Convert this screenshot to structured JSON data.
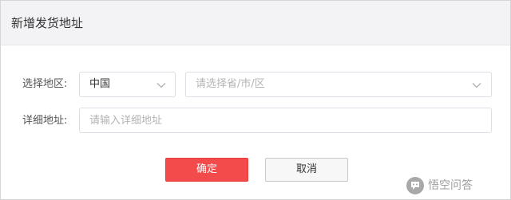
{
  "dialog": {
    "title": "新增发货地址"
  },
  "form": {
    "region_label": "选择地区:",
    "country_value": "中国",
    "province_placeholder": "请选择省/市/区",
    "detail_label": "详细地址:",
    "detail_placeholder": "请输入详细地址",
    "detail_value": ""
  },
  "actions": {
    "confirm_label": "确定",
    "cancel_label": "取消"
  },
  "watermark": {
    "text": "悟空问答"
  },
  "colors": {
    "primary": "#f34b4b",
    "header_bg": "#f3f3f5",
    "border": "#dcdfe6"
  }
}
